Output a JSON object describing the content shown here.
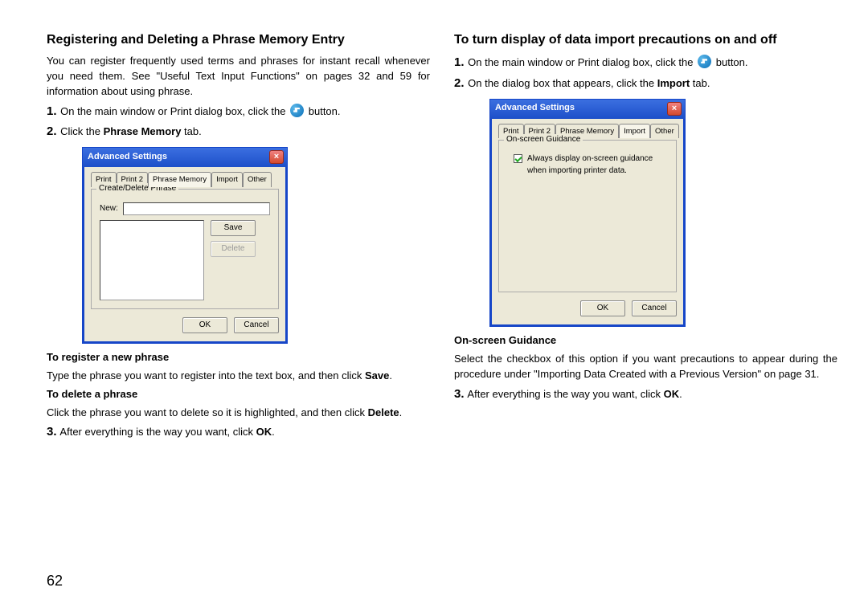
{
  "page_number": "62",
  "left": {
    "heading": "Registering and Deleting a Phrase Memory Entry",
    "intro": "You can register frequently used terms and phrases for instant recall whenever you need them. See \"Useful Text Input Functions\" on pages 32 and 59 for information about using phrase.",
    "step1_pre": "On the main window or Print dialog box, click the",
    "step1_post": " button.",
    "step2": "Click the ",
    "step2_bold": "Phrase Memory",
    "step2_post": " tab.",
    "register_h": "To register a new phrase",
    "register_t": "Type the phrase you want to register into the text box, and then click ",
    "register_b": "Save",
    "delete_h": "To delete a phrase",
    "delete_t": "Click the phrase you want to delete so it is highlighted, and then click ",
    "delete_b": "Delete",
    "step3": "After everything is the way you want, click ",
    "step3_b": "OK",
    "dlg": {
      "title": "Advanced Settings",
      "tabs": [
        "Print",
        "Print 2",
        "Phrase Memory",
        "Import",
        "Other"
      ],
      "gb": "Create/Delete Phrase",
      "new_lbl": "New:",
      "save": "Save",
      "delete": "Delete",
      "ok": "OK",
      "cancel": "Cancel"
    }
  },
  "right": {
    "heading": "To turn display of data import precautions on and off",
    "step1_pre": "On the main window or Print dialog box, click the",
    "step1_post": " button.",
    "step2": "On the dialog box that appears, click the ",
    "step2_b": "Import",
    "step2_post": " tab.",
    "dlg": {
      "title": "Advanced Settings",
      "tabs": [
        "Print",
        "Print 2",
        "Phrase Memory",
        "Import",
        "Other"
      ],
      "gb": "On-screen Guidance",
      "chk": "Always display on-screen guidance when importing printer data.",
      "ok": "OK",
      "cancel": "Cancel"
    },
    "osg_h": "On-screen Guidance",
    "osg_t": "Select the checkbox of this option if you want precautions to appear during the procedure under \"Importing Data Created with a Previous Version\" on page 31.",
    "step3": "After everything is the way you want, click ",
    "step3_b": "OK"
  }
}
